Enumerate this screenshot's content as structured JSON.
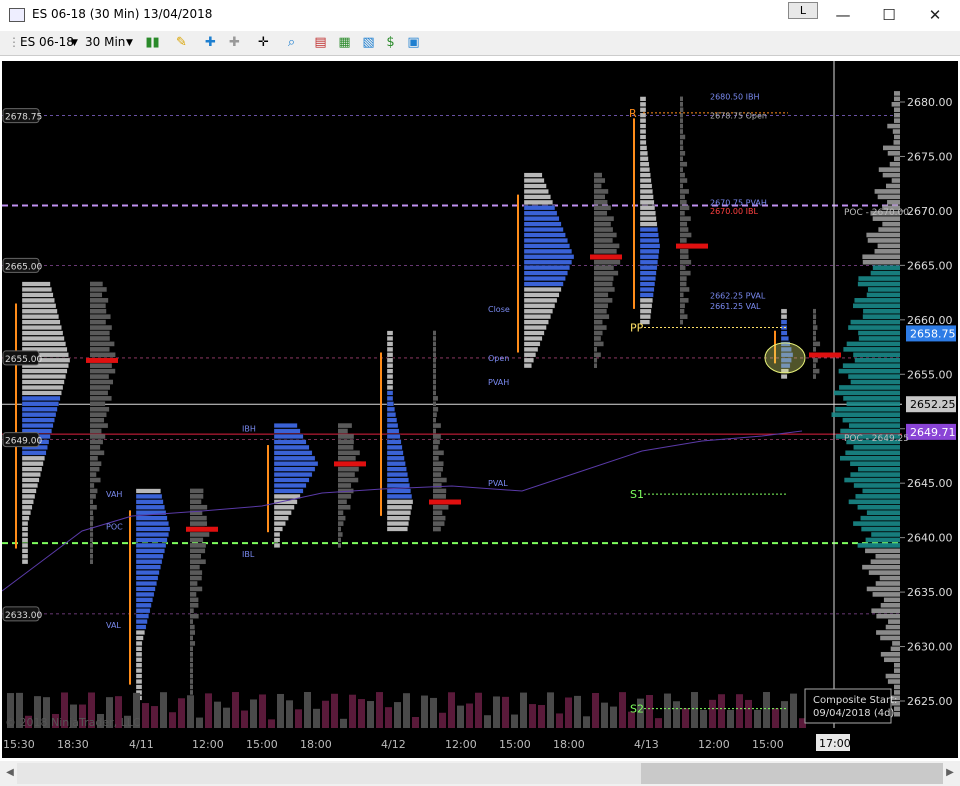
{
  "window": {
    "title": "ES 06-18 (30 Min)  13/04/2018",
    "l_button": "L",
    "minimize": "—",
    "maximize": "☐",
    "close": "✕"
  },
  "toolbar": {
    "instrument": "ES 06-18",
    "interval": "30 Min",
    "icons": [
      "bar-chart-icon",
      "pencil-icon",
      "add-indicator-icon",
      "strategy-icon",
      "crosshair-icon",
      "zoom-icon",
      "data-box-icon",
      "chart-style-icon",
      "properties-icon",
      "dollar-icon",
      "layout-icon"
    ]
  },
  "chart": {
    "watermark": "© 2018 NinjaTrader, LLC",
    "price_axis": [
      "2680.00",
      "2675.00",
      "2670.00",
      "2665.00",
      "2660.00",
      "2655.00",
      "2650.00",
      "2645.00",
      "2640.00",
      "2635.00",
      "2630.00",
      "2625.00"
    ],
    "price_badges": [
      {
        "text": "2658.75",
        "color": "#2d7ce6"
      },
      {
        "text": "2652.25",
        "color": "#c8c8c8"
      },
      {
        "text": "2649.71",
        "color": "#8a44d6"
      }
    ],
    "left_labels": [
      "2678.75",
      "2665.00",
      "2655.00",
      "2649.00",
      "2633.00"
    ],
    "time_axis": [
      "15:30",
      "18:30",
      "4/11",
      "12:00",
      "15:00",
      "18:00",
      "4/12",
      "12:00",
      "15:00",
      "18:00",
      "4/13",
      "12:00",
      "15:00"
    ],
    "time_cursor": "17:00",
    "composite": {
      "line1": "Composite Start:",
      "line2": "09/04/2018 (4d)"
    },
    "pivots": [
      "R",
      "PP",
      "S1",
      "S2"
    ],
    "poc_right": [
      "POC - 2670.00",
      "POC - 2649.25"
    ],
    "levels": [
      "2680.50 IBH",
      "2678.75 Open",
      "2670.75 PVAH",
      "2670.00 IBL",
      "2662.25 PVAL",
      "2661.25 VAL"
    ],
    "session_labels": [
      "VAH",
      "POC",
      "VAL",
      "IBH",
      "IBL",
      "Open",
      "Close",
      "PVAH",
      "PVAL"
    ],
    "colors": {
      "profile_blue": "#3a62d6",
      "profile_grey": "#b8b8b8",
      "poc_red": "#e01010",
      "teal": "#1a8a8a",
      "vwap": "#5a3aa8",
      "dashed_green": "#7fff5f",
      "dashed_violet": "#c090f0"
    }
  }
}
